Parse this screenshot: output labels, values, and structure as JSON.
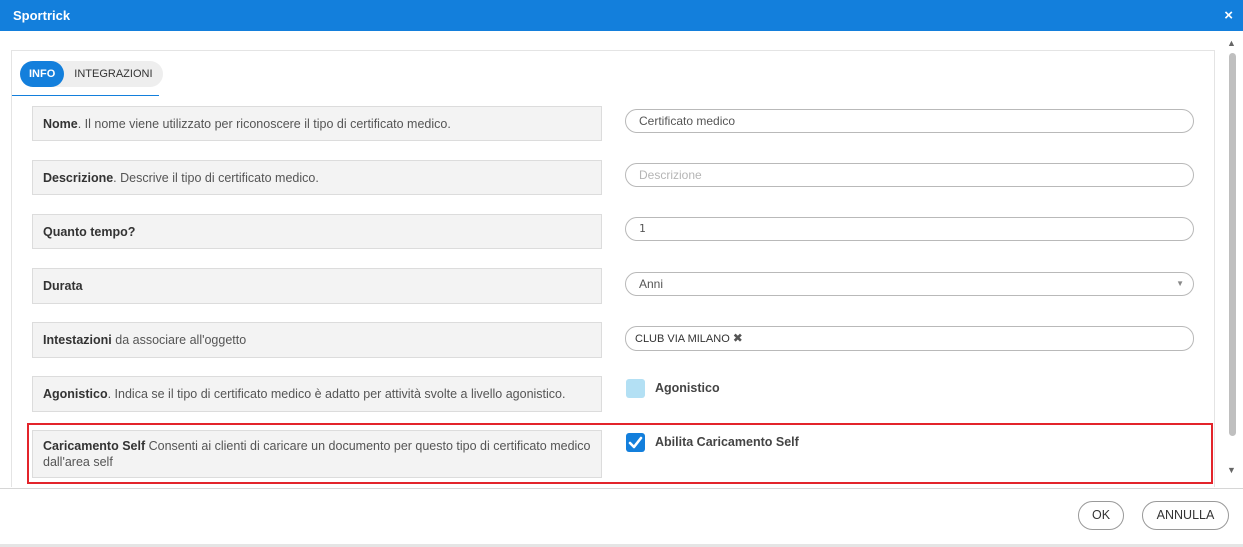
{
  "window": {
    "title": "Sportrick",
    "close_glyph": "×"
  },
  "tabs": [
    {
      "label": "INFO",
      "active": true
    },
    {
      "label": "INTEGRAZIONI",
      "active": false
    }
  ],
  "rows": {
    "nome": {
      "label_bold": "Nome",
      "label_text": ". Il nome viene utilizzato per riconoscere il tipo di certificato medico.",
      "value": "Certificato medico"
    },
    "descrizione": {
      "label_bold": "Descrizione",
      "label_text": ". Descrive il tipo di certificato medico.",
      "placeholder": "Descrizione"
    },
    "quanto_tempo": {
      "label_bold": "Quanto tempo?",
      "value": "1"
    },
    "durata": {
      "label_bold": "Durata",
      "value": "Anni",
      "caret": "▼"
    },
    "intestazioni": {
      "label_bold": "Intestazioni",
      "label_text": " da associare all'oggetto",
      "tag": "CLUB VIA MILANO",
      "tag_remove": "✖"
    },
    "agonistico": {
      "label_bold": "Agonistico",
      "label_text": ". Indica se il tipo di certificato medico è adatto per attività svolte a livello agonistico.",
      "checkbox_label": "Agonistico",
      "checked": false
    },
    "caricamento_self": {
      "label_bold": "Caricamento Self",
      "label_text": " Consenti ai clienti di caricare un documento per questo tipo di certificato medico dall'area self",
      "checkbox_label": "Abilita Caricamento Self",
      "checked": true
    }
  },
  "scrollbar": {
    "up": "▲",
    "down": "▼"
  },
  "footer": {
    "ok_label": "OK",
    "cancel_label": "ANNULLA"
  },
  "colors": {
    "accent": "#137fdc",
    "highlight": "#e3242b",
    "checkbox_off": "#b3e0f4"
  }
}
